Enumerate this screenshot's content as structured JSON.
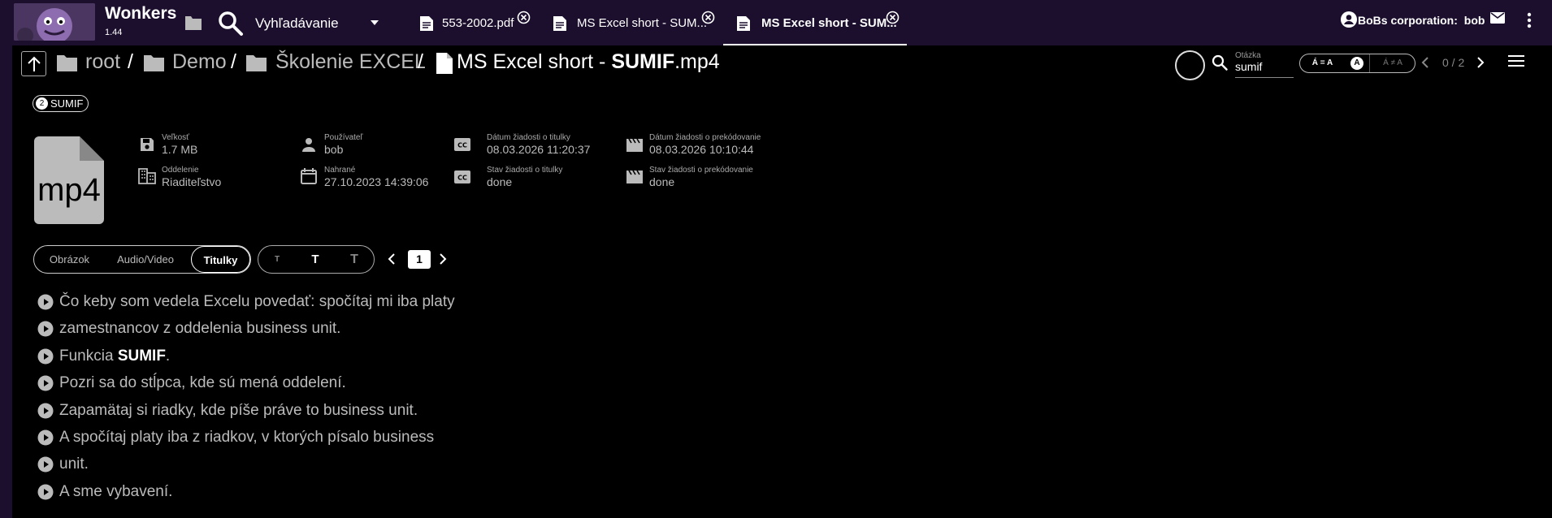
{
  "app": {
    "title": "Wonkers",
    "version": "1.44",
    "search_label": "Vyhľadávanie"
  },
  "tabs": [
    {
      "label": "553-2002.pdf"
    },
    {
      "label": "MS Excel short - SUM..."
    },
    {
      "label": "MS Excel short - SUM...",
      "active": true
    }
  ],
  "user": {
    "org_label": "BoBs corporation:",
    "name": "bob"
  },
  "breadcrumb": {
    "items": [
      "root",
      "Demo",
      "Školenie EXCEL"
    ],
    "separator": "/",
    "file_prefix": "MS Excel short - ",
    "file_highlight": "SUMIF",
    "file_suffix": ".mp4"
  },
  "search": {
    "label": "Otázka",
    "value": "sumif",
    "case_a": "Á = A",
    "case_b": "A",
    "case_c": "Á ≠ A",
    "match_count": "0 / 2"
  },
  "tag": {
    "count": "2",
    "label": "SUMIF"
  },
  "file": {
    "ext": "mp4"
  },
  "meta": {
    "size": {
      "label": "Veľkosť",
      "value": "1.7 MB"
    },
    "department": {
      "label": "Oddelenie",
      "value": "Riaditeľstvo"
    },
    "user": {
      "label": "Používateľ",
      "value": "bob"
    },
    "uploaded": {
      "label": "Nahrané",
      "value": "27.10.2023 14:39:06"
    },
    "subs_req_date": {
      "label": "Dátum žiadosti o titulky",
      "value": "08.03.2026 11:20:37"
    },
    "subs_req_state": {
      "label": "Stav žiadosti o titulky",
      "value": "done"
    },
    "trans_req_date": {
      "label": "Dátum žiadosti o prekódovanie",
      "value": "08.03.2026 10:10:44"
    },
    "trans_req_state": {
      "label": "Stav žiadosti o prekódovanie",
      "value": "done"
    }
  },
  "view_tabs": {
    "image": "Obrázok",
    "audio_video": "Audio/Video",
    "subtitles": "Titulky",
    "active": "subtitles"
  },
  "text_size": {
    "small": "T",
    "medium": "T",
    "large": "T",
    "active": "medium"
  },
  "pager": {
    "page": "1"
  },
  "subtitles": [
    {
      "pre": "Čo keby som vedela Excelu povedať: spočítaj mi iba platy",
      "hl": "",
      "post": ""
    },
    {
      "pre": "zamestnancov z oddelenia business unit.",
      "hl": "",
      "post": ""
    },
    {
      "pre": "Funkcia ",
      "hl": "SUMIF",
      "post": "."
    },
    {
      "pre": "Pozri sa do stĺpca, kde sú mená oddelení.",
      "hl": "",
      "post": ""
    },
    {
      "pre": "Zapamätaj si riadky, kde píše práve to business unit.",
      "hl": "",
      "post": ""
    },
    {
      "pre": "A spočítaj platy iba z riadkov, v ktorých písalo business",
      "hl": "",
      "post": ""
    },
    {
      "pre": "unit.",
      "hl": "",
      "post": ""
    },
    {
      "pre": "A sme vybavení.",
      "hl": "",
      "post": ""
    }
  ]
}
